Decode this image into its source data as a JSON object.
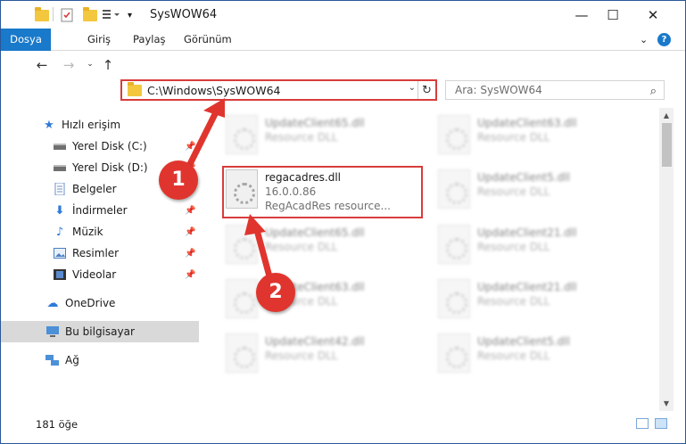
{
  "window": {
    "title": "SysWOW64",
    "controls": {
      "minimize": "—",
      "maximize": "☐",
      "close": "✕"
    }
  },
  "ribbon": {
    "tabs": [
      {
        "label": "Dosya"
      },
      {
        "label": "Giriş"
      },
      {
        "label": "Paylaş"
      },
      {
        "label": "Görünüm"
      }
    ],
    "help_icon": "?"
  },
  "nav": {
    "address": "C:\\Windows\\SysWOW64",
    "search_placeholder": "Ara: SysWOW64"
  },
  "sidebar": {
    "items": [
      {
        "label": "Hızlı erişim",
        "icon": "star-icon"
      },
      {
        "label": "Yerel Disk (C:)",
        "icon": "drive-icon"
      },
      {
        "label": "Yerel Disk (D:)",
        "icon": "drive-icon"
      },
      {
        "label": "Belgeler",
        "icon": "document-icon"
      },
      {
        "label": "İndirmeler",
        "icon": "download-icon"
      },
      {
        "label": "Müzik",
        "icon": "music-icon"
      },
      {
        "label": "Resimler",
        "icon": "picture-icon"
      },
      {
        "label": "Videolar",
        "icon": "video-icon"
      },
      {
        "label": "OneDrive",
        "icon": "cloud-icon"
      },
      {
        "label": "Bu bilgisayar",
        "icon": "computer-icon"
      },
      {
        "label": "Ağ",
        "icon": "network-icon"
      }
    ]
  },
  "files": {
    "r0c0": {
      "name": "UpdateClient65.dll",
      "desc": "Resource DLL"
    },
    "r0c1": {
      "name": "UpdateClient63.dll",
      "desc": "Resource DLL"
    },
    "r1c0": {
      "name": "regacadres.dll",
      "version": "16.0.0.86",
      "desc": "RegAcadRes resource..."
    },
    "r1c1": {
      "name": "UpdateClient5.dll",
      "desc": "Resource DLL"
    },
    "r2c0": {
      "name": "UpdateClient65.dll",
      "desc": "Resource DLL"
    },
    "r2c1": {
      "name": "UpdateClient21.dll",
      "desc": "Resource DLL"
    },
    "r3c0": {
      "name": "UpdateClient63.dll",
      "desc": "Resource DLL"
    },
    "r3c1": {
      "name": "UpdateClient21.dll",
      "desc": "Resource DLL"
    },
    "r4c0": {
      "name": "UpdateClient42.dll",
      "desc": "Resource DLL"
    },
    "r4c1": {
      "name": "UpdateClient5.dll",
      "desc": "Resource DLL"
    }
  },
  "status": {
    "count": "181 öğe"
  },
  "annotations": {
    "step1": "1",
    "step2": "2",
    "color": "#e0352e"
  }
}
